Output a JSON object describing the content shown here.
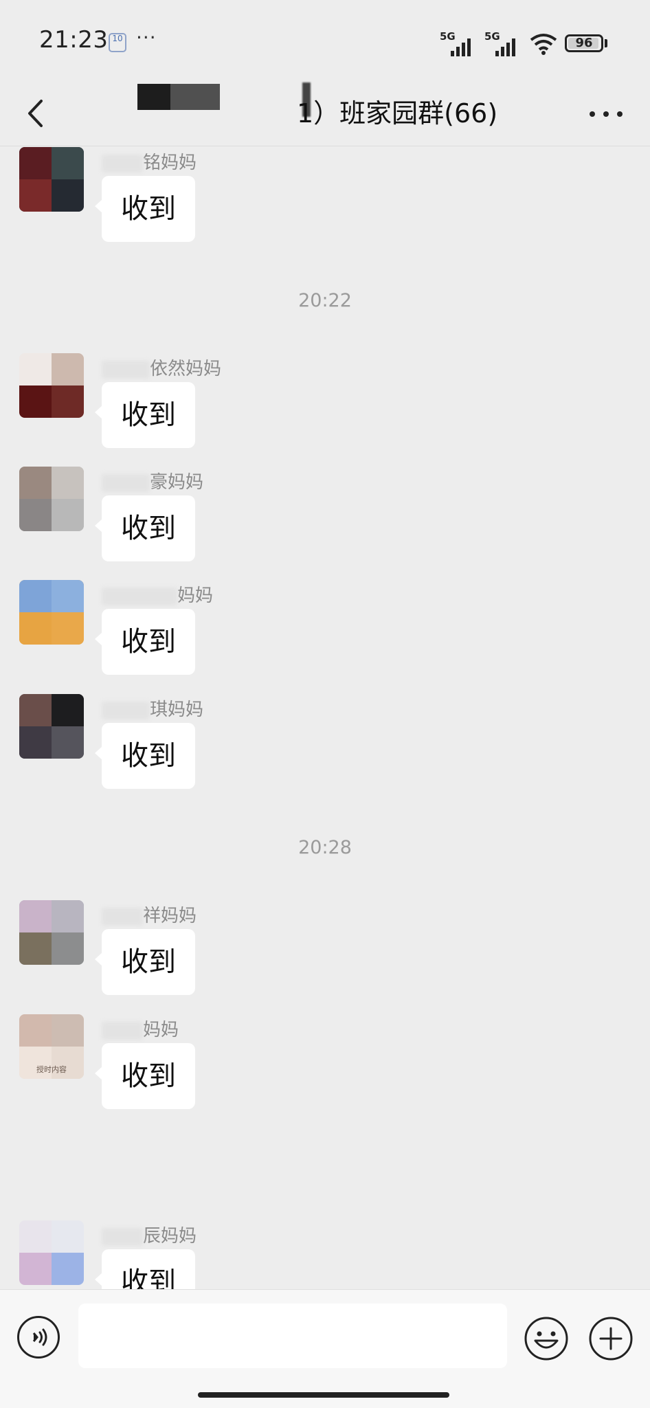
{
  "status_bar": {
    "time": "21:23",
    "notification_badge": "10",
    "more_dots": "···",
    "network_1": "5G",
    "network_2": "5G",
    "battery": "96",
    "battery_level_percent": 96
  },
  "nav": {
    "title": "1）班家园群(66)",
    "back_icon": "chevron-left-icon",
    "more_icon": "more-horizontal-icon"
  },
  "messages": [
    {
      "sender": "铭妈妈",
      "text": "收到"
    },
    {
      "timestamp": "20:22"
    },
    {
      "sender": "依然妈妈",
      "text": "收到"
    },
    {
      "sender": "豪妈妈",
      "text": "收到"
    },
    {
      "sender": "妈妈",
      "text": "收到"
    },
    {
      "sender": "琪妈妈",
      "text": "收到"
    },
    {
      "timestamp": "20:28"
    },
    {
      "sender": "祥妈妈",
      "text": "收到"
    },
    {
      "sender": "妈妈",
      "text": "收到"
    },
    {
      "sender": "辰妈妈",
      "text": "收到"
    }
  ],
  "avatar_overlay_text": "授时内容",
  "input_bar": {
    "voice_icon": "voice-icon",
    "input_value": "",
    "emoji_icon": "emoji-icon",
    "plus_icon": "plus-circle-icon"
  }
}
